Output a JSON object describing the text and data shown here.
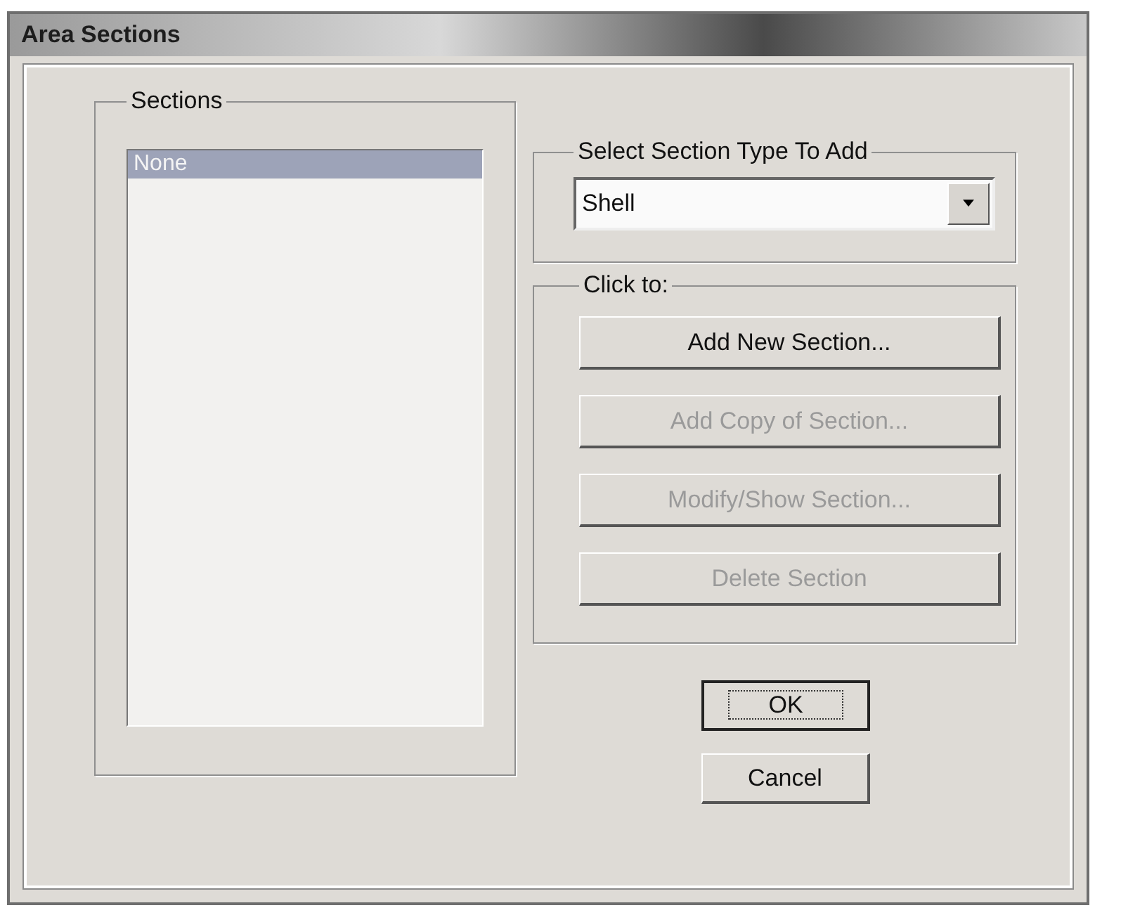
{
  "window": {
    "title": "Area Sections"
  },
  "sections": {
    "label": "Sections",
    "items": [
      {
        "label": "None",
        "selected": true
      }
    ]
  },
  "section_type": {
    "label": "Select Section Type To Add",
    "value": "Shell"
  },
  "click_to": {
    "label": "Click to:",
    "buttons": [
      {
        "label": "Add New Section...",
        "disabled": false
      },
      {
        "label": "Add Copy of Section...",
        "disabled": true
      },
      {
        "label": "Modify/Show Section...",
        "disabled": true
      },
      {
        "label": "Delete Section",
        "disabled": true
      }
    ]
  },
  "dialog_buttons": [
    {
      "label": "OK",
      "focused": true
    },
    {
      "label": "Cancel",
      "focused": false
    }
  ]
}
